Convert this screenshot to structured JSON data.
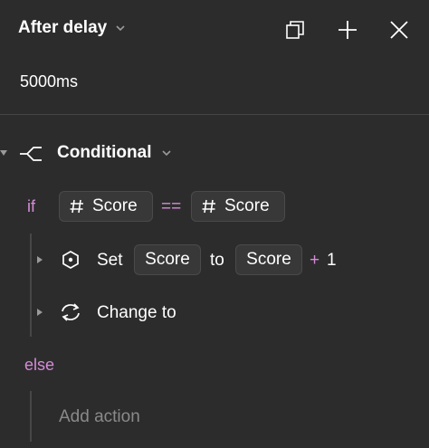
{
  "header": {
    "title": "After delay"
  },
  "delay": {
    "value": "5000ms"
  },
  "conditional": {
    "label": "Conditional",
    "if_keyword": "if",
    "left_operand": "Score",
    "operator": "==",
    "right_operand": "Score",
    "else_keyword": "else"
  },
  "actions": [
    {
      "verb": "Set",
      "target": "Score",
      "to_word": "to",
      "source": "Score",
      "op": "+",
      "amount": "1"
    },
    {
      "label": "Change to"
    }
  ],
  "else_branch": {
    "add_action_label": "Add action"
  },
  "colors": {
    "background": "#2c2c2c",
    "keyword": "#d58bd8",
    "muted": "#8a8a8a",
    "pill": "#383838"
  }
}
